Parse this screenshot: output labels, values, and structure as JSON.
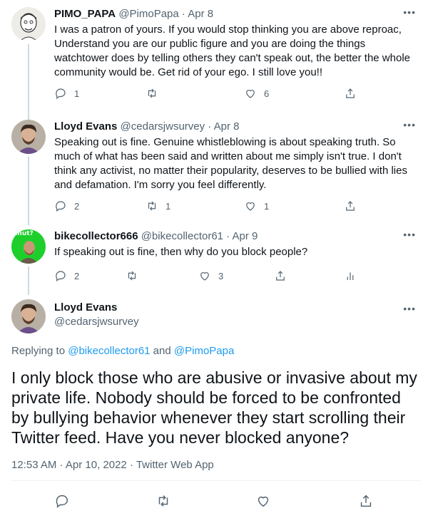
{
  "tweets": [
    {
      "name": "PIMO_PAPA",
      "handle": "@PimoPapa",
      "sep": "·",
      "date": "Apr 8",
      "more": "•••",
      "text": "I was a patron of yours. If you would stop thinking you are above reproac, Understand you are our public figure and you are doing the things watchtower does by telling others they can't speak out, the better the whole community would be. Get rid of your ego. I still love you!!",
      "replies": "1",
      "retweets": "",
      "likes": "6"
    },
    {
      "name": "Lloyd Evans",
      "handle": "@cedarsjwsurvey",
      "sep": "·",
      "date": "Apr 8",
      "more": "•••",
      "text": "Speaking out is fine. Genuine whistleblowing is about speaking truth. So much of what has been said and written about me simply isn't true. I don't think any activist, no matter their popularity, deserves to be bullied with lies and defamation. I'm sorry you feel differently.",
      "replies": "2",
      "retweets": "1",
      "likes": "1"
    },
    {
      "name": "bikecollector666",
      "handle": "@bikecollector61",
      "sep": "·",
      "date": "Apr 9",
      "more": "•••",
      "avatar_text": "uhut?",
      "text": "If speaking out is fine, then why do you block people?",
      "replies": "2",
      "retweets": "",
      "likes": "3"
    }
  ],
  "main": {
    "name": "Lloyd Evans",
    "handle": "@cedarsjwsurvey",
    "more": "•••",
    "replying_prefix": "Replying to ",
    "replying_to_1": "@bikecollector61",
    "replying_and": " and ",
    "replying_to_2": "@PimoPapa",
    "text": "I only block those who are abusive or invasive about my private life. Nobody should be forced to be confronted by bullying behavior whenever they start scrolling their Twitter feed. Have you never blocked anyone?",
    "timestamp": "12:53 AM · Apr 10, 2022 · Twitter Web App"
  },
  "colors": {
    "link": "#1d9bf0",
    "secondary": "#536471",
    "text": "#0f1419",
    "thread_line": "#cfd9de"
  },
  "icons": [
    "reply-icon",
    "retweet-icon",
    "like-icon",
    "share-icon",
    "analytics-icon",
    "more-icon"
  ]
}
